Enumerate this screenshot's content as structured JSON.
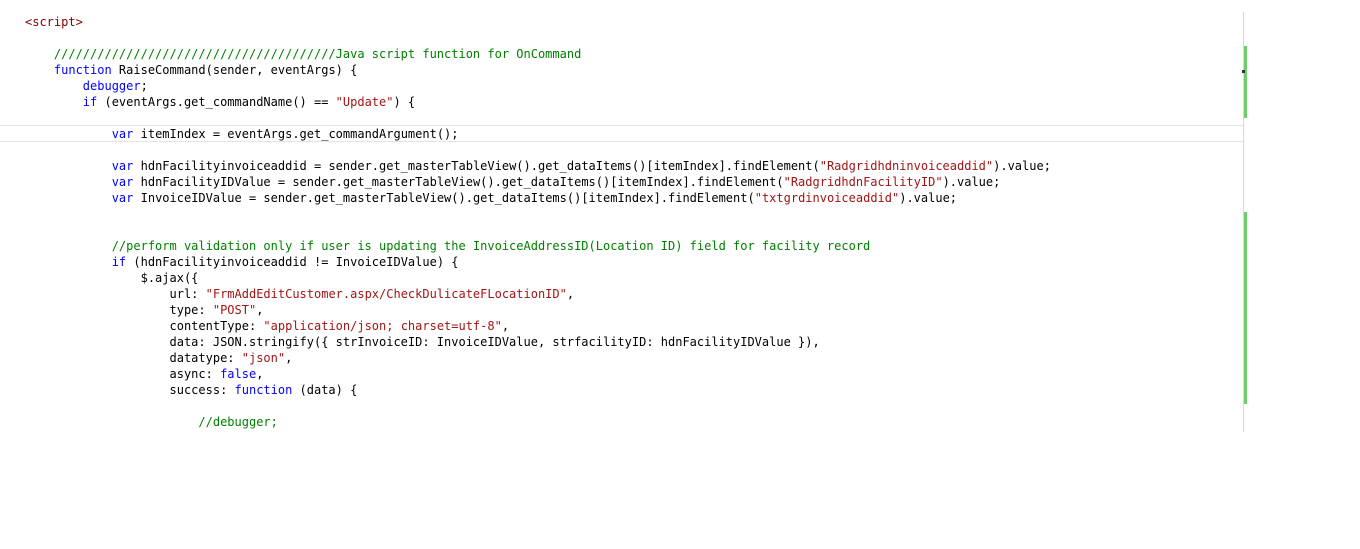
{
  "editor": {
    "colors": {
      "plain": "#000000",
      "keyword": "#0000ff",
      "string": "#a31515",
      "comment": "#008000",
      "tag": "#800000",
      "changed_bar": "#6ccf6c"
    },
    "lines": [
      {
        "tokens": [
          {
            "k": "g",
            "t": "<script>"
          }
        ]
      },
      {
        "tokens": []
      },
      {
        "tokens": [
          {
            "k": "c",
            "t": "    ///////////////////////////////////////Java script function for OnCommand"
          }
        ]
      },
      {
        "tokens": [
          {
            "k": "p",
            "t": "    "
          },
          {
            "k": "k",
            "t": "function"
          },
          {
            "k": "p",
            "t": " RaiseCommand(sender, eventArgs) {"
          }
        ]
      },
      {
        "tokens": [
          {
            "k": "p",
            "t": "        "
          },
          {
            "k": "k",
            "t": "debugger"
          },
          {
            "k": "p",
            "t": ";"
          }
        ]
      },
      {
        "tokens": [
          {
            "k": "p",
            "t": "        "
          },
          {
            "k": "k",
            "t": "if"
          },
          {
            "k": "p",
            "t": " (eventArgs.get_commandName() == "
          },
          {
            "k": "s",
            "t": "\"Update\""
          },
          {
            "k": "p",
            "t": ") {"
          }
        ]
      },
      {
        "tokens": []
      },
      {
        "tokens": [
          {
            "k": "p",
            "t": "            "
          },
          {
            "k": "k",
            "t": "var"
          },
          {
            "k": "p",
            "t": " itemIndex = eventArgs.get_commandArgument();"
          }
        ]
      },
      {
        "tokens": []
      },
      {
        "tokens": [
          {
            "k": "p",
            "t": "            "
          },
          {
            "k": "k",
            "t": "var"
          },
          {
            "k": "p",
            "t": " hdnFacilityinvoiceaddid = sender.get_masterTableView().get_dataItems()[itemIndex].findElement("
          },
          {
            "k": "s",
            "t": "\"Radgridhdninvoiceaddid\""
          },
          {
            "k": "p",
            "t": ").value;"
          }
        ]
      },
      {
        "tokens": [
          {
            "k": "p",
            "t": "            "
          },
          {
            "k": "k",
            "t": "var"
          },
          {
            "k": "p",
            "t": " hdnFacilityIDValue = sender.get_masterTableView().get_dataItems()[itemIndex].findElement("
          },
          {
            "k": "s",
            "t": "\"RadgridhdnFacilityID\""
          },
          {
            "k": "p",
            "t": ").value;"
          }
        ]
      },
      {
        "tokens": [
          {
            "k": "p",
            "t": "            "
          },
          {
            "k": "k",
            "t": "var"
          },
          {
            "k": "p",
            "t": " InvoiceIDValue = sender.get_masterTableView().get_dataItems()[itemIndex].findElement("
          },
          {
            "k": "s",
            "t": "\"txtgrdinvoiceaddid\""
          },
          {
            "k": "p",
            "t": ").value;"
          }
        ]
      },
      {
        "tokens": []
      },
      {
        "tokens": []
      },
      {
        "tokens": [
          {
            "k": "c",
            "t": "            //perform validation only if user is updating the InvoiceAddressID(Location ID) field for facility record"
          }
        ]
      },
      {
        "tokens": [
          {
            "k": "p",
            "t": "            "
          },
          {
            "k": "k",
            "t": "if"
          },
          {
            "k": "p",
            "t": " (hdnFacilityinvoiceaddid != InvoiceIDValue) {"
          }
        ]
      },
      {
        "tokens": [
          {
            "k": "p",
            "t": "                $.ajax({"
          }
        ]
      },
      {
        "tokens": [
          {
            "k": "p",
            "t": "                    url: "
          },
          {
            "k": "s",
            "t": "\"FrmAddEditCustomer.aspx/CheckDulicateFLocationID\""
          },
          {
            "k": "p",
            "t": ","
          }
        ]
      },
      {
        "tokens": [
          {
            "k": "p",
            "t": "                    type: "
          },
          {
            "k": "s",
            "t": "\"POST\""
          },
          {
            "k": "p",
            "t": ","
          }
        ]
      },
      {
        "tokens": [
          {
            "k": "p",
            "t": "                    contentType: "
          },
          {
            "k": "s",
            "t": "\"application/json; charset=utf-8\""
          },
          {
            "k": "p",
            "t": ","
          }
        ]
      },
      {
        "tokens": [
          {
            "k": "p",
            "t": "                    data: JSON.stringify({ strInvoiceID: InvoiceIDValue, strfacilityID: hdnFacilityIDValue }),"
          }
        ]
      },
      {
        "tokens": [
          {
            "k": "p",
            "t": "                    datatype: "
          },
          {
            "k": "s",
            "t": "\"json\""
          },
          {
            "k": "p",
            "t": ","
          }
        ]
      },
      {
        "tokens": [
          {
            "k": "p",
            "t": "                    async: "
          },
          {
            "k": "k",
            "t": "false"
          },
          {
            "k": "p",
            "t": ","
          }
        ]
      },
      {
        "tokens": [
          {
            "k": "p",
            "t": "                    success: "
          },
          {
            "k": "k",
            "t": "function"
          },
          {
            "k": "p",
            "t": " (data) {"
          }
        ]
      },
      {
        "tokens": []
      },
      {
        "tokens": [
          {
            "k": "c",
            "t": "                        //debugger;"
          }
        ]
      }
    ]
  }
}
